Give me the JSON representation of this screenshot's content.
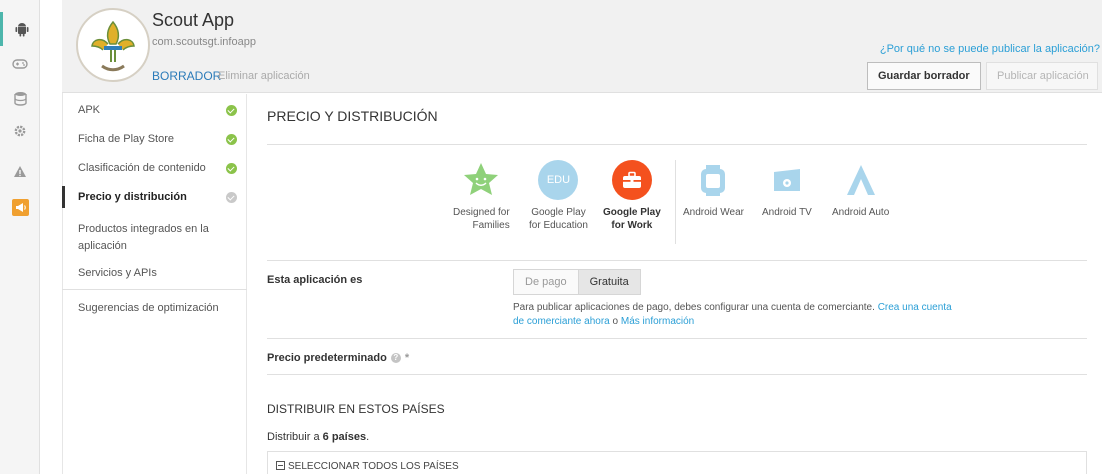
{
  "app": {
    "name": "Scout App",
    "package": "com.scoutsgt.infoapp",
    "status": "BORRADOR",
    "delete_label": "Eliminar aplicación"
  },
  "header": {
    "why_link": "¿Por qué no se puede publicar la aplicación?",
    "save_draft_label": "Guardar borrador",
    "publish_label": "Publicar aplicación"
  },
  "rail": {
    "icons": [
      "android-icon",
      "gamepad-icon",
      "database-icon",
      "gear-icon",
      "warning-icon",
      "megaphone-icon"
    ]
  },
  "nav": {
    "items": [
      {
        "label": "APK",
        "status": "complete"
      },
      {
        "label": "Ficha de Play Store",
        "status": "complete"
      },
      {
        "label": "Clasificación de contenido",
        "status": "complete"
      },
      {
        "label": "Precio y distribución",
        "status": "pending"
      },
      {
        "label": "Productos integrados en la aplicación"
      },
      {
        "label": "Servicios y APIs"
      },
      {
        "label": "Sugerencias de optimización"
      }
    ]
  },
  "main": {
    "title": "PRECIO Y DISTRIBUCIÓN",
    "programs": [
      {
        "label1": "Designed for",
        "label2": "Families",
        "icon": "star-face-icon",
        "color": "#8fd17a"
      },
      {
        "label1": "Google Play",
        "label2": "for Education",
        "icon": "edu-icon",
        "icon_text": "EDU",
        "color": "#a9d5ec"
      },
      {
        "label1": "Google Play",
        "label2": "for Work",
        "icon": "briefcase-icon",
        "color": "#f4511e",
        "selected": true
      },
      {
        "label1": "Android Wear",
        "label2": "",
        "icon": "watch-icon",
        "color": "#a9d5ec"
      },
      {
        "label1": "Android TV",
        "label2": "",
        "icon": "tv-icon",
        "color": "#a9d5ec"
      },
      {
        "label1": "Android Auto",
        "label2": "",
        "icon": "auto-icon",
        "color": "#a9d5ec"
      }
    ],
    "app_type_label": "Esta aplicación es",
    "paid_label": "De pago",
    "free_label": "Gratuita",
    "note_text": "Para publicar aplicaciones de pago, debes configurar una cuenta de comerciante.",
    "note_link1": "Crea una cuenta de comerciante ahora",
    "note_or": "o",
    "note_link2": "Más información",
    "default_price_label": "Precio predeterminado",
    "required_mark": "*",
    "distribute_title": "DISTRIBUIR EN ESTOS PAÍSES",
    "distribute_prefix": "Distribuir a",
    "distribute_count": "6 países",
    "select_all_label": "SELECCIONAR TODOS LOS PAÍSES"
  },
  "colors": {
    "accent": "#2b9fd6",
    "complete": "#8bc34a",
    "work_orange": "#f4511e"
  }
}
